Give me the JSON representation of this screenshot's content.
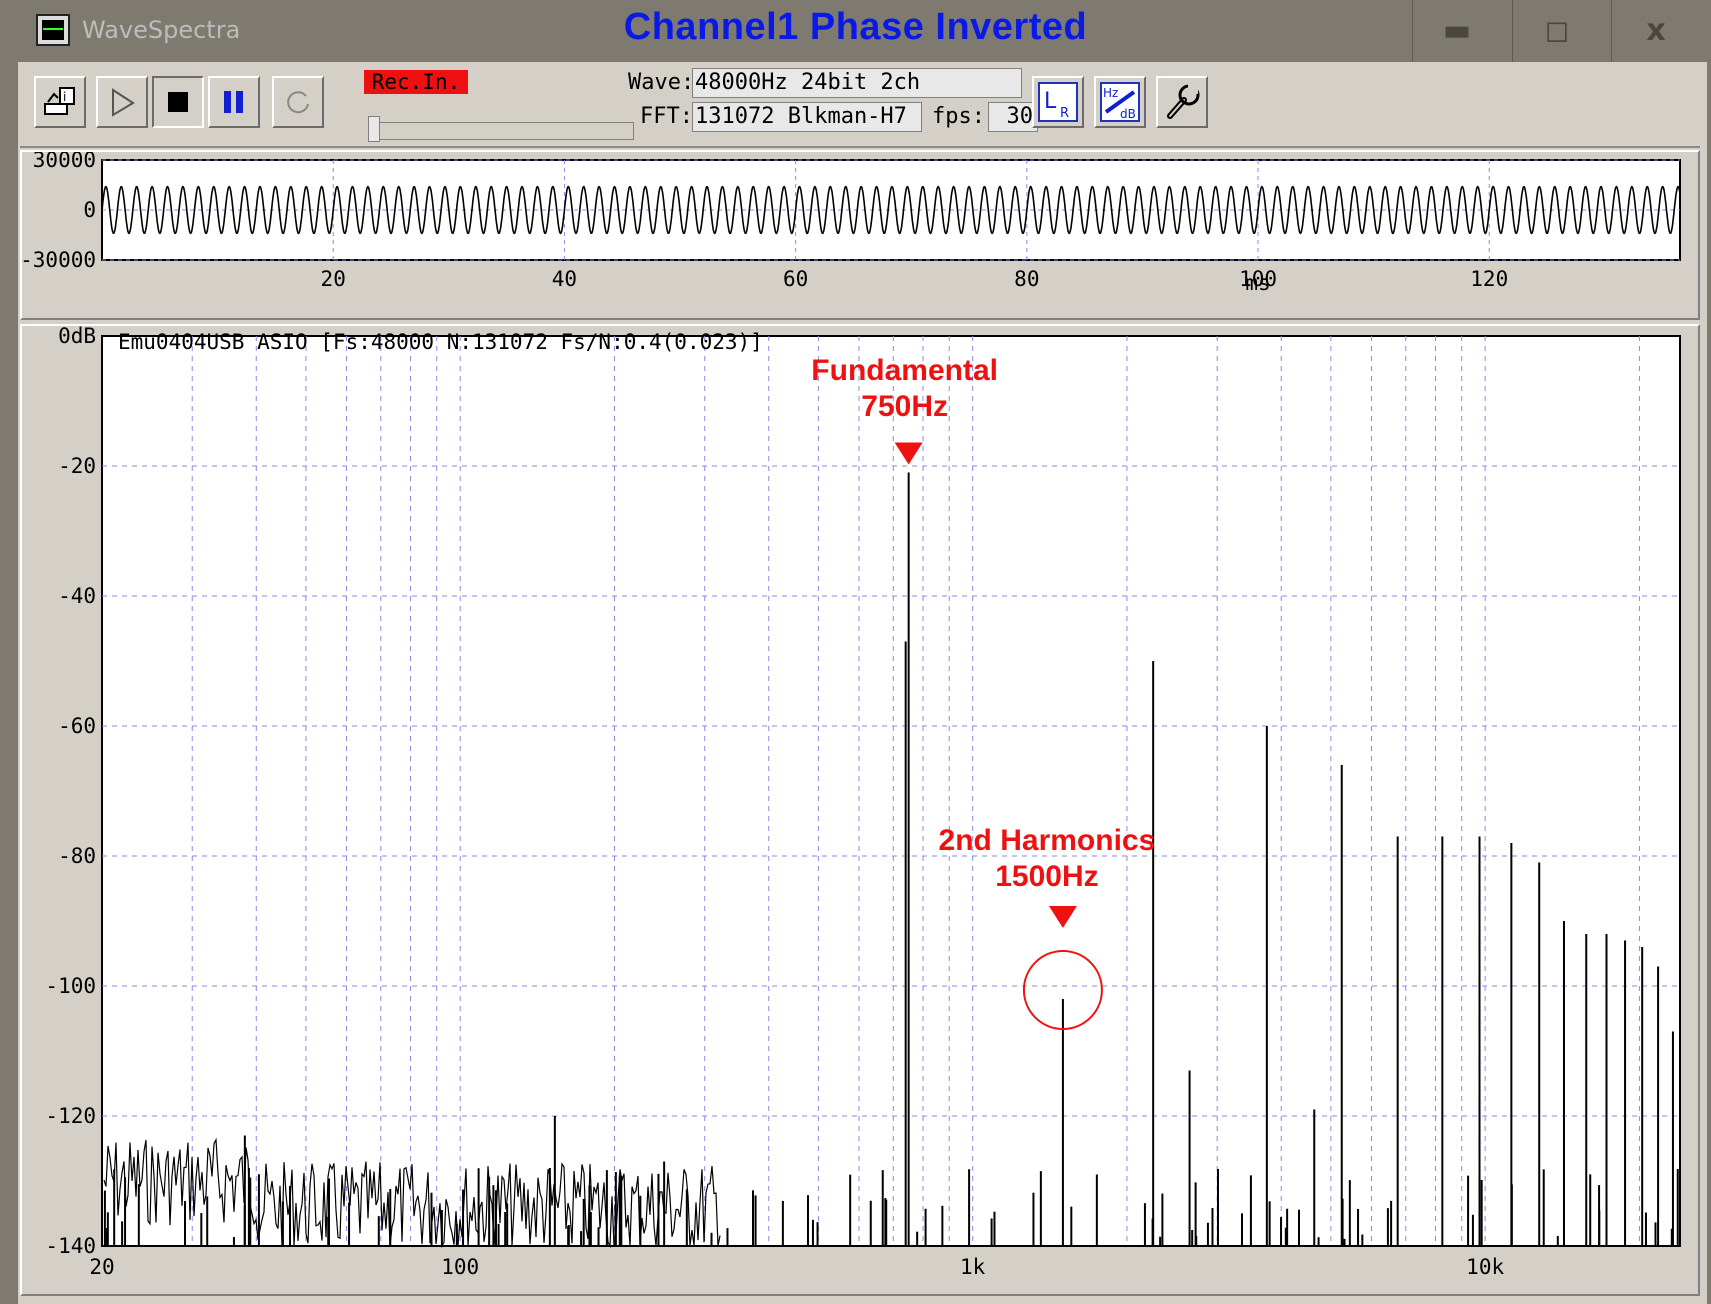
{
  "window": {
    "app_name": "WaveSpectra",
    "headline": "Channel1 Phase Inverted",
    "minimize_glyph": "▬",
    "maximize_glyph": "◻",
    "close_glyph": "x"
  },
  "toolbar": {
    "rec_input_label": "Rec.In.",
    "wave_label": "Wave:",
    "wave_value": "48000Hz 24bit 2ch",
    "fft_label": "FFT:",
    "fft_value": "131072 Blkman-H7",
    "fps_label": "fps:",
    "fps_value": "30",
    "buttons": [
      "open-file-icon",
      "play-icon",
      "stop-icon",
      "pause-icon",
      "loop-icon",
      "lr-channel-icon",
      "hz-db-scale-icon",
      "settings-wrench-icon"
    ],
    "input_level_fraction": 0.0
  },
  "waveform": {
    "y_ticks": [
      "30000",
      "0",
      "-30000"
    ],
    "x_ticks": [
      "20",
      "40",
      "60",
      "80",
      "100",
      "120"
    ],
    "x_unit": "ms",
    "y_range": [
      -30000,
      30000
    ],
    "x_range_ms": [
      0,
      136.5
    ],
    "frequency_hz": 750,
    "amplitude": 14000
  },
  "spectrum": {
    "header": "Emu0404USB ASIO   [Fs:48000 N:131072 Fs/N:0.4(0.023)]",
    "y_ticks": [
      "0dB",
      "-20",
      "-40",
      "-60",
      "-80",
      "-100",
      "-120",
      "-140"
    ],
    "x_ticks": [
      "20",
      "100",
      "1k",
      "10k"
    ],
    "annotations": {
      "fundamental_line1": "Fundamental",
      "fundamental_line2": "750Hz",
      "harmonic_line1": "2nd Harmonics",
      "harmonic_line2": "1500Hz"
    },
    "accent_color": "#ee1111"
  },
  "chart_data": {
    "type": "line",
    "x_scale": "log",
    "xlim": [
      20,
      24000
    ],
    "ylim": [
      -140,
      0
    ],
    "xlabel": "",
    "ylabel": "",
    "grid": true,
    "peaks": [
      {
        "x": 38,
        "y": -123
      },
      {
        "x": 153,
        "y": -120
      },
      {
        "x": 250,
        "y": -127
      },
      {
        "x": 740,
        "y": -47
      },
      {
        "x": 750,
        "y": -21
      },
      {
        "x": 1500,
        "y": -102
      },
      {
        "x": 2250,
        "y": -50
      },
      {
        "x": 2650,
        "y": -113
      },
      {
        "x": 3750,
        "y": -60
      },
      {
        "x": 4640,
        "y": -119
      },
      {
        "x": 5250,
        "y": -66
      },
      {
        "x": 6750,
        "y": -77
      },
      {
        "x": 8250,
        "y": -77
      },
      {
        "x": 9750,
        "y": -77
      },
      {
        "x": 11250,
        "y": -78
      },
      {
        "x": 12750,
        "y": -81
      },
      {
        "x": 14250,
        "y": -90
      },
      {
        "x": 15750,
        "y": -92
      },
      {
        "x": 17250,
        "y": -92
      },
      {
        "x": 18750,
        "y": -93
      },
      {
        "x": 20250,
        "y": -94
      },
      {
        "x": 21750,
        "y": -97
      },
      {
        "x": 23250,
        "y": -107
      }
    ]
  }
}
